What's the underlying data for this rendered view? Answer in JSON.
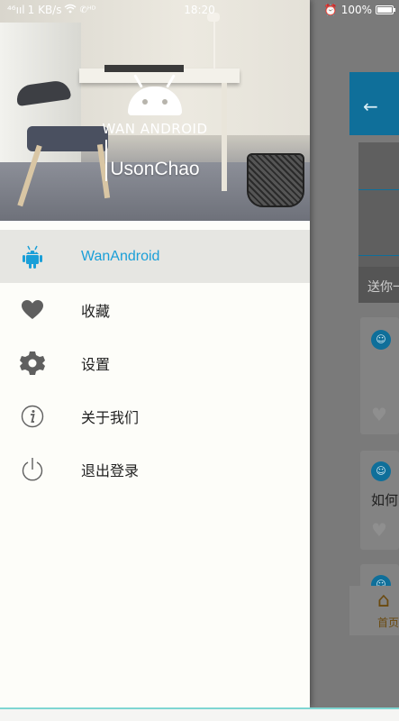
{
  "status_bar": {
    "signal": "⁴⁶ııl",
    "speed": "1 KB/s",
    "time": "18:20",
    "battery": "100%",
    "battery_level": 1.0
  },
  "drawer": {
    "header": {
      "logo_text": "WAN ANDROID",
      "user_name": "UsonChao"
    },
    "menu": [
      {
        "label": "WanAndroid",
        "icon": "android-icon",
        "active": true
      },
      {
        "label": "收藏",
        "icon": "heart-icon",
        "active": false
      },
      {
        "label": "设置",
        "icon": "gear-icon",
        "active": false
      },
      {
        "label": "关于我们",
        "icon": "info-icon",
        "active": false
      },
      {
        "label": "退出登录",
        "icon": "power-icon",
        "active": false
      }
    ]
  },
  "background": {
    "banner_caption": "送你一",
    "card2_text": "如何",
    "home_label": "首页"
  },
  "colors": {
    "accent": "#1a9fd8",
    "active_row": "#e6e6e2",
    "drawer_bg": "#fdfdf9",
    "toolbar": "#0f6f9a"
  }
}
